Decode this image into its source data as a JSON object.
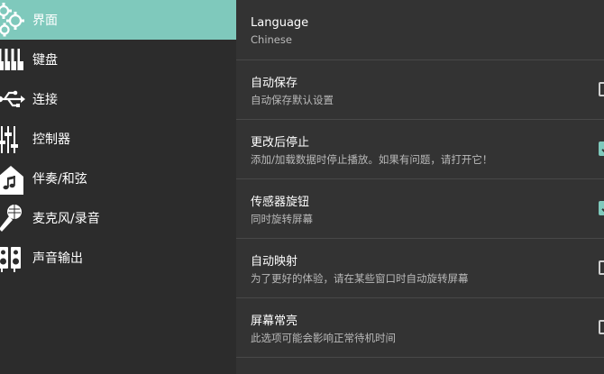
{
  "sidebar": {
    "items": [
      {
        "label": "界面",
        "icon": "gears-icon",
        "active": true
      },
      {
        "label": "键盘",
        "icon": "piano-keys-icon",
        "active": false
      },
      {
        "label": "连接",
        "icon": "usb-icon",
        "active": false
      },
      {
        "label": "控制器",
        "icon": "sliders-icon",
        "active": false
      },
      {
        "label": "伴奏/和弦",
        "icon": "music-house-icon",
        "active": false
      },
      {
        "label": "麦克风/录音",
        "icon": "microphone-icon",
        "active": false
      },
      {
        "label": "声音输出",
        "icon": "speakers-icon",
        "active": false
      }
    ],
    "active_color": "#7fc9bc"
  },
  "settings": [
    {
      "title": "Language",
      "subtitle": "Chinese",
      "checkbox": "none"
    },
    {
      "title": "自动保存",
      "subtitle": "自动保存默认设置",
      "checkbox": "unchecked"
    },
    {
      "title": "更改后停止",
      "subtitle": "添加/加载数据时停止播放。如果有问题，请打开它！",
      "checkbox": "checked"
    },
    {
      "title": "传感器旋钮",
      "subtitle": "同时旋转屏幕",
      "checkbox": "checked"
    },
    {
      "title": "自动映射",
      "subtitle": "为了更好的体验，请在某些窗口时自动旋转屏幕",
      "checkbox": "unchecked"
    },
    {
      "title": "屏幕常亮",
      "subtitle": "此选项可能会影响正常待机时间",
      "checkbox": "unchecked"
    }
  ]
}
